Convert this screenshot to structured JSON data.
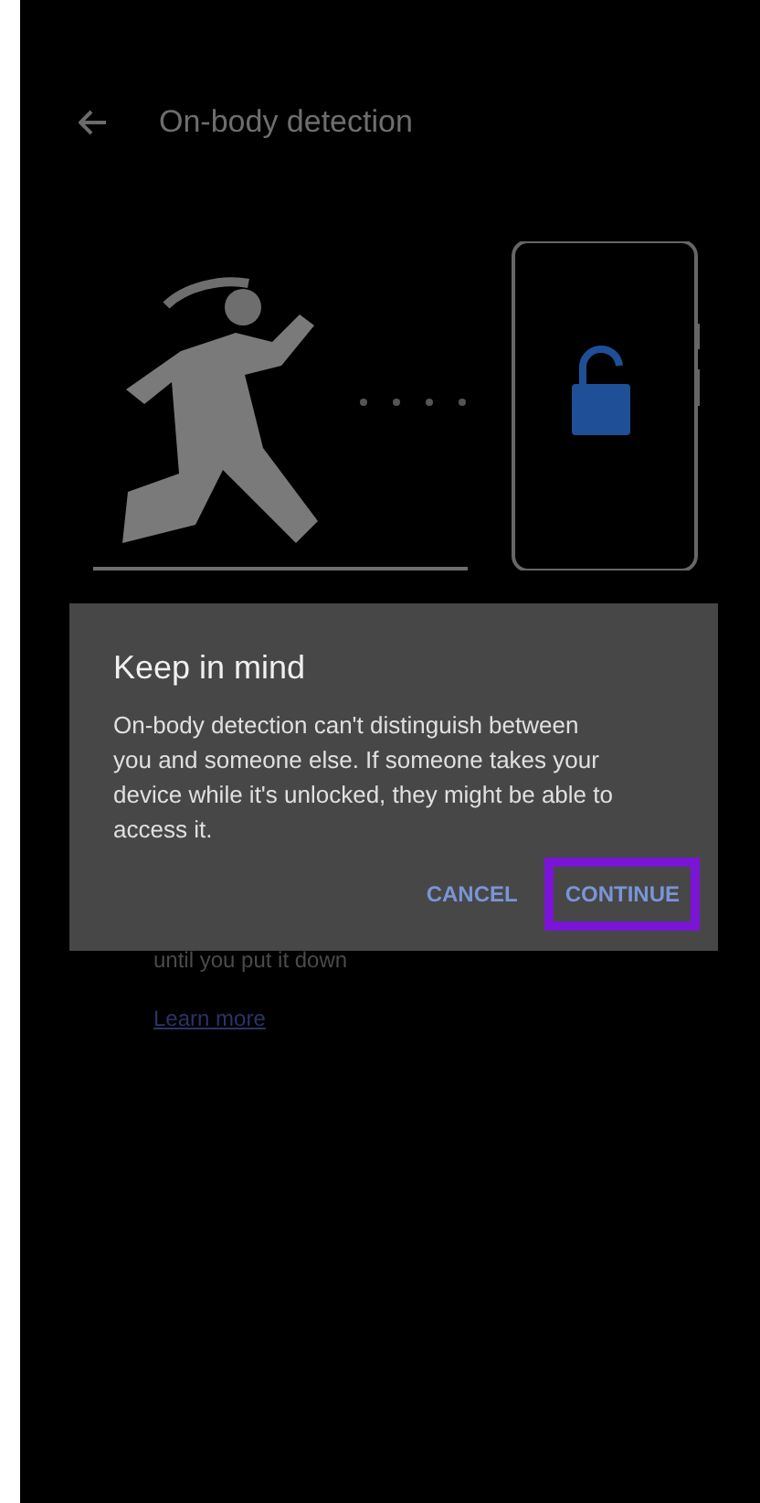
{
  "header": {
    "title": "On-body detection"
  },
  "body": {
    "description_tail": "until you put it down",
    "link": "Learn more"
  },
  "dialog": {
    "title": "Keep in mind",
    "message": "On-body detection can't distinguish between you and someone else. If someone takes your device while it's unlocked, they might be able to access it.",
    "buttons": [
      {
        "label": "CANCEL",
        "highlighted": false
      },
      {
        "label": "CONTINUE",
        "highlighted": true
      }
    ]
  }
}
